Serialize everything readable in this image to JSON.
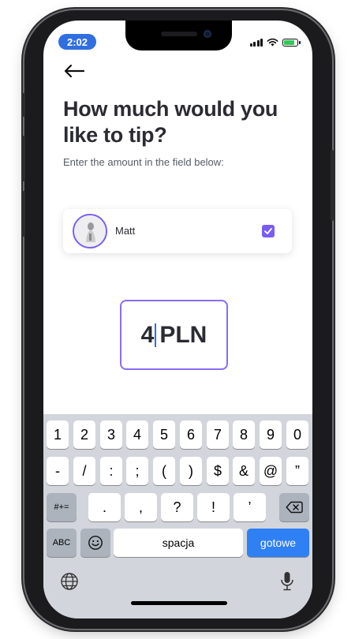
{
  "status_bar": {
    "time": "2:02"
  },
  "header": {
    "title": "How much would you like to tip?",
    "subtitle": "Enter the amount in the field below:"
  },
  "recipient": {
    "name": "Matt",
    "selected": true
  },
  "amount": {
    "value": "4",
    "currency": "PLN"
  },
  "keyboard": {
    "row1": [
      "1",
      "2",
      "3",
      "4",
      "5",
      "6",
      "7",
      "8",
      "9",
      "0"
    ],
    "row2": [
      "-",
      "/",
      ":",
      ";",
      "(",
      ")",
      "$",
      "&",
      "@",
      "”"
    ],
    "row3": [
      ".",
      ",",
      "?",
      "!",
      "’"
    ],
    "mode_key": "#+=",
    "abc_key": "ABC",
    "space_label": "spacja",
    "done_label": "gotowe"
  },
  "colors": {
    "accent": "#7a5cf5",
    "keyboard_done": "#2f80f5",
    "time_pill": "#2f6fe0"
  }
}
